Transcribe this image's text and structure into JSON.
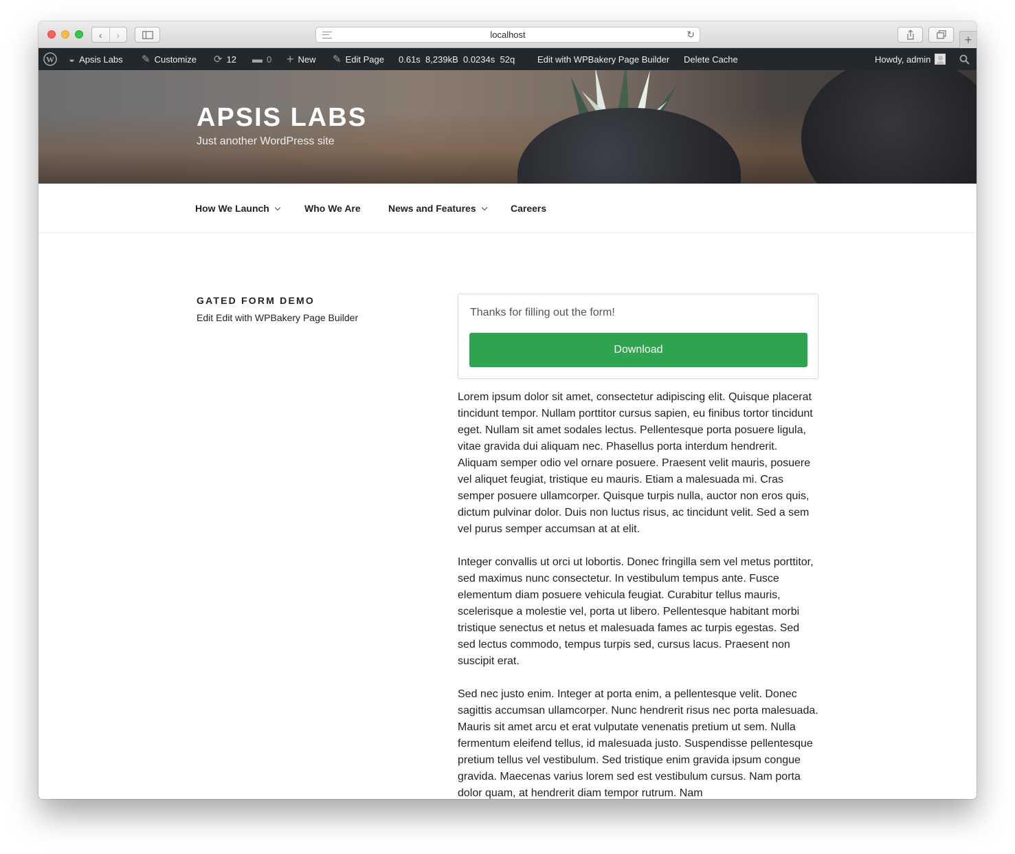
{
  "browser": {
    "url": "localhost"
  },
  "adminbar": {
    "site_name": "Apsis Labs",
    "customize": "Customize",
    "updates_count": "12",
    "comments_count": "0",
    "new": "New",
    "edit_page": "Edit Page",
    "perf_time": "0.61s",
    "perf_memory": "8,239kB",
    "perf_query_time": "0.0234s",
    "perf_queries": "52q",
    "wpbakery": "Edit with WPBakery Page Builder",
    "delete_cache": "Delete Cache",
    "howdy": "Howdy, admin"
  },
  "header": {
    "site_title": "APSIS LABS",
    "tagline": "Just another WordPress site"
  },
  "nav": {
    "items": [
      {
        "label": "How We Launch",
        "has_dropdown": true
      },
      {
        "label": "Who We Are",
        "has_dropdown": false
      },
      {
        "label": "News and Features",
        "has_dropdown": true
      },
      {
        "label": "Careers",
        "has_dropdown": false
      }
    ]
  },
  "entry": {
    "title": "GATED FORM DEMO",
    "edit_link": "Edit",
    "wpbakery_link": "Edit with WPBakery Page Builder"
  },
  "form": {
    "thanks_message": "Thanks for filling out the form!",
    "download_label": "Download",
    "button_color": "#2ea44f"
  },
  "content": {
    "paragraphs": [
      "Lorem ipsum dolor sit amet, consectetur adipiscing elit. Quisque placerat tincidunt tempor. Nullam porttitor cursus sapien, eu finibus tortor tincidunt eget. Nullam sit amet sodales lectus. Pellentesque porta posuere ligula, vitae gravida dui aliquam nec. Phasellus porta interdum hendrerit. Aliquam semper odio vel ornare posuere. Praesent velit mauris, posuere vel aliquet feugiat, tristique eu mauris. Etiam a malesuada mi. Cras semper posuere ullamcorper. Quisque turpis nulla, auctor non eros quis, dictum pulvinar dolor. Duis non luctus risus, ac tincidunt velit. Sed a sem vel purus semper accumsan at at elit.",
      "Integer convallis ut orci ut lobortis. Donec fringilla sem vel metus porttitor, sed maximus nunc consectetur. In vestibulum tempus ante. Fusce elementum diam posuere vehicula feugiat. Curabitur tellus mauris, scelerisque a molestie vel, porta ut libero. Pellentesque habitant morbi tristique senectus et netus et malesuada fames ac turpis egestas. Sed sed lectus commodo, tempus turpis sed, cursus lacus. Praesent non suscipit erat.",
      "Sed nec justo enim. Integer at porta enim, a pellentesque velit. Donec sagittis accumsan ullamcorper. Nunc hendrerit risus nec porta malesuada. Mauris sit amet arcu et erat vulputate venenatis pretium ut sem. Nulla fermentum eleifend tellus, id malesuada justo. Suspendisse pellentesque pretium tellus vel vestibulum. Sed tristique enim gravida ipsum congue gravida. Maecenas varius lorem sed est vestibulum cursus. Nam porta dolor quam, at hendrerit diam tempor rutrum. Nam"
    ]
  }
}
